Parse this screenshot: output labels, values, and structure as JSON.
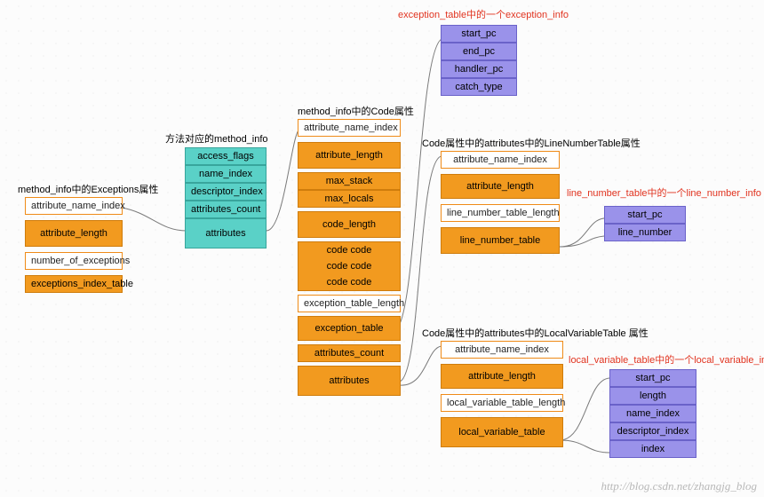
{
  "titles": {
    "exceptions_attr": "method_info中的Exceptions属性",
    "method_info": "方法对应的method_info",
    "code_attr": "method_info中的Code属性",
    "exception_info": "exception_table中的一个exception_info",
    "lnt": "Code属性中的attributes中的LineNumberTable属性",
    "line_number_info": "line_number_table中的一个line_number_info",
    "lvt": "Code属性中的attributes中的LocalVariableTable 属性",
    "local_variable_info": "local_variable_table中的一个local_variable_info"
  },
  "exceptions_attr": {
    "h0": "attribute_name_index",
    "r0": "attribute_length",
    "h1": "number_of_exceptions",
    "r1": "exceptions_index_table"
  },
  "method_info": {
    "r0": "access_flags",
    "r1": "name_index",
    "r2": "descriptor_index",
    "r3": "attributes_count",
    "r4": "attributes"
  },
  "code_attr": {
    "h0": "attribute_name_index",
    "r0": "attribute_length",
    "r1": "max_stack",
    "r2": "max_locals",
    "r3": "code_length",
    "r4a": "code code",
    "r4b": "code code",
    "r4c": "code code",
    "h1": "exception_table_length",
    "r5": "exception_table",
    "r6": "attributes_count",
    "r7": "attributes"
  },
  "exception_info": {
    "r0": "start_pc",
    "r1": "end_pc",
    "r2": "handler_pc",
    "r3": "catch_type"
  },
  "lnt": {
    "h0": "attribute_name_index",
    "r0": "attribute_length",
    "h1": "line_number_table_length",
    "r1": "line_number_table"
  },
  "line_number_info": {
    "r0": "start_pc",
    "r1": "line_number"
  },
  "lvt": {
    "h0": "attribute_name_index",
    "r0": "attribute_length",
    "h1": "local_variable_table_length",
    "r1": "local_variable_table"
  },
  "local_variable_info": {
    "r0": "start_pc",
    "r1": "length",
    "r2": "name_index",
    "r3": "descriptor_index",
    "r4": "index"
  },
  "watermark": "http://blog.csdn.net/zhangjg_blog"
}
